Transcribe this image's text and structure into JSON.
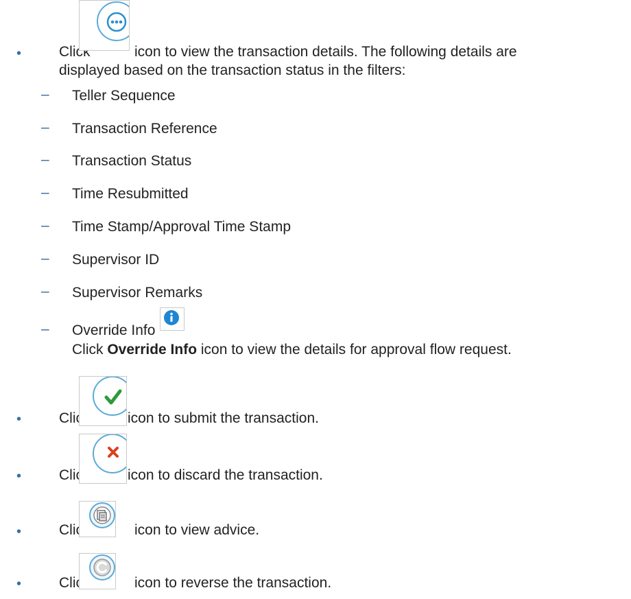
{
  "intro": {
    "click": "Click",
    "line1_rest": "icon to view the transaction details. The following details are",
    "line2": "displayed based on the transaction status in the filters:"
  },
  "details": [
    "Teller Sequence",
    "Transaction Reference",
    "Transaction Status",
    "Time Resubmitted",
    "Time Stamp/Approval Time Stamp",
    "Supervisor ID",
    "Supervisor Remarks",
    "Override Info"
  ],
  "override_note": {
    "prefix": "Click",
    "bold": "Override Info",
    "suffix": "icon to view the details for approval flow request."
  },
  "actions": [
    {
      "click": "Click",
      "text": "icon to submit the transaction.",
      "icon": "submit-check-icon"
    },
    {
      "click": "Click",
      "text": "icon to discard the transaction.",
      "icon": "discard-x-icon"
    },
    {
      "click": "Click",
      "text": "icon to view advice.",
      "icon": "view-advice-icon"
    },
    {
      "click": "Click",
      "text": "icon to reverse the transaction.",
      "icon": "reverse-icon"
    }
  ],
  "colors": {
    "bullet": "#3a6ea5",
    "icon_ring": "#5aaad8",
    "check": "#2e9a3a",
    "cross": "#d9411e",
    "info": "#1f86d1"
  }
}
